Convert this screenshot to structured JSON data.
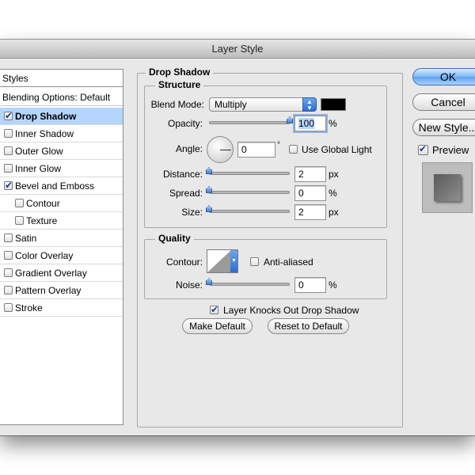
{
  "window": {
    "title": "Layer Style"
  },
  "sidebar": {
    "header": "Styles",
    "blending_options": "Blending Options: Default",
    "items": [
      {
        "label": "Drop Shadow",
        "checked": true,
        "selected": true,
        "indent": false
      },
      {
        "label": "Inner Shadow",
        "checked": false,
        "selected": false,
        "indent": false
      },
      {
        "label": "Outer Glow",
        "checked": false,
        "selected": false,
        "indent": false
      },
      {
        "label": "Inner Glow",
        "checked": false,
        "selected": false,
        "indent": false
      },
      {
        "label": "Bevel and Emboss",
        "checked": true,
        "selected": false,
        "indent": false
      },
      {
        "label": "Contour",
        "checked": false,
        "selected": false,
        "indent": true
      },
      {
        "label": "Texture",
        "checked": false,
        "selected": false,
        "indent": true
      },
      {
        "label": "Satin",
        "checked": false,
        "selected": false,
        "indent": false
      },
      {
        "label": "Color Overlay",
        "checked": false,
        "selected": false,
        "indent": false
      },
      {
        "label": "Gradient Overlay",
        "checked": false,
        "selected": false,
        "indent": false
      },
      {
        "label": "Pattern Overlay",
        "checked": false,
        "selected": false,
        "indent": false
      },
      {
        "label": "Stroke",
        "checked": false,
        "selected": false,
        "indent": false
      }
    ]
  },
  "panel": {
    "title": "Drop Shadow",
    "structure": {
      "legend": "Structure",
      "blend_mode_label": "Blend Mode:",
      "blend_mode_value": "Multiply",
      "shadow_color": "#000000",
      "opacity_label": "Opacity:",
      "opacity_value": "100",
      "opacity_fraction": 1.0,
      "opacity_unit": "%",
      "angle_label": "Angle:",
      "angle_value": "0",
      "angle_unit": "°",
      "use_global_light_label": "Use Global Light",
      "use_global_light_checked": false,
      "distance_label": "Distance:",
      "distance_value": "2",
      "distance_fraction": 0.0,
      "distance_unit": "px",
      "spread_label": "Spread:",
      "spread_value": "0",
      "spread_fraction": 0.0,
      "spread_unit": "%",
      "size_label": "Size:",
      "size_value": "2",
      "size_fraction": 0.0,
      "size_unit": "px"
    },
    "quality": {
      "legend": "Quality",
      "contour_label": "Contour:",
      "anti_aliased_label": "Anti-aliased",
      "anti_aliased_checked": false,
      "noise_label": "Noise:",
      "noise_value": "0",
      "noise_fraction": 0.0,
      "noise_unit": "%"
    },
    "knockout_label": "Layer Knocks Out Drop Shadow",
    "knockout_checked": true,
    "make_default_label": "Make Default",
    "reset_default_label": "Reset to Default"
  },
  "actions": {
    "ok_label": "OK",
    "cancel_label": "Cancel",
    "new_style_label": "New Style...",
    "preview_label": "Preview",
    "preview_checked": true
  }
}
